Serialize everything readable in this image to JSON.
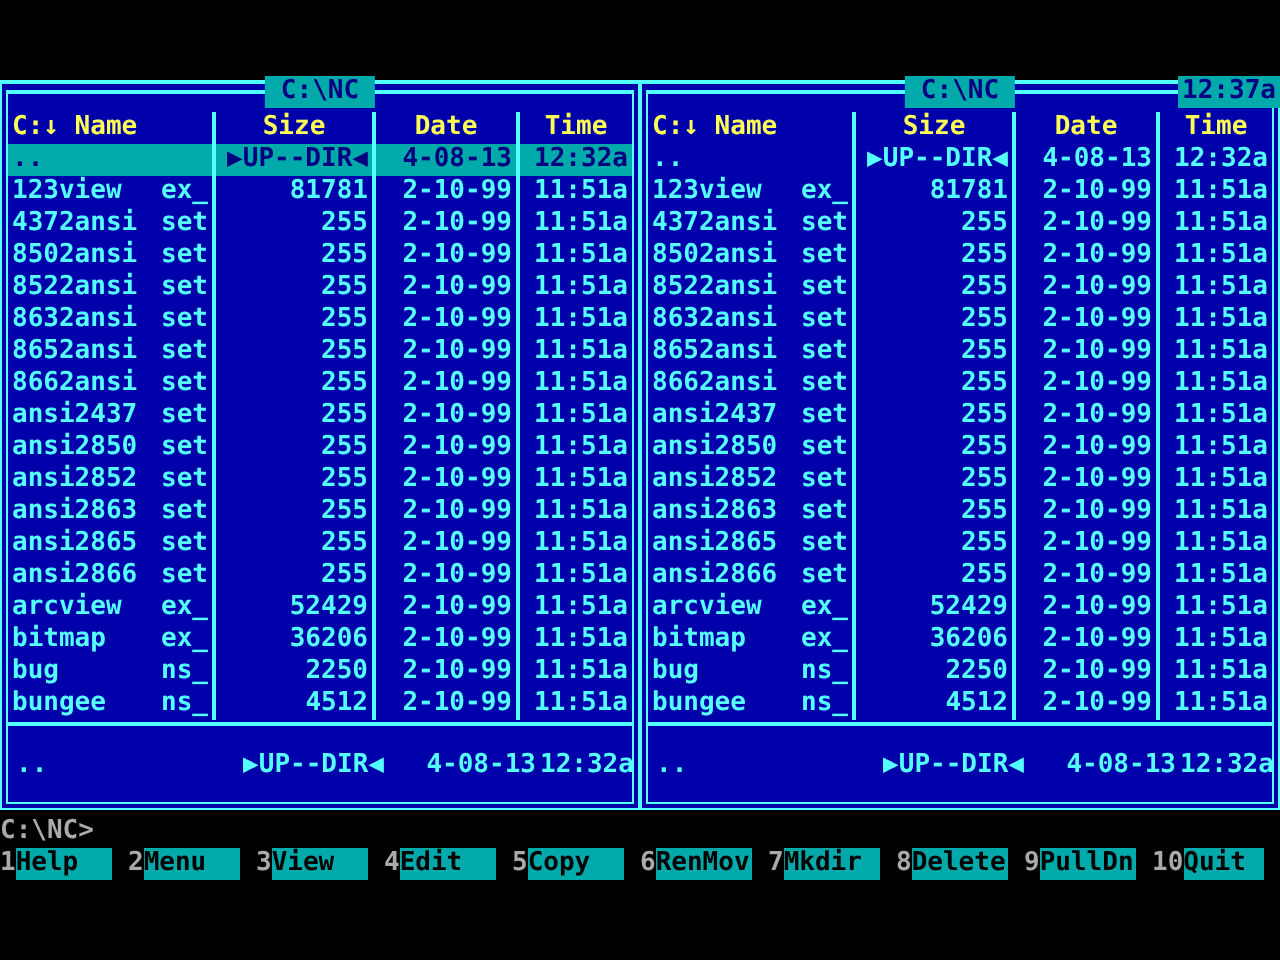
{
  "panels": [
    {
      "path": "C:\\NC",
      "columns": [
        "C:↓ Name",
        "Size",
        "Date",
        "Time"
      ],
      "files": [
        {
          "name": "..",
          "size": "▶UP--DIR◀",
          "date": "4-08-13",
          "time": "12:32a",
          "selected": true
        },
        {
          "name": "123view",
          "ext": "ex_",
          "size": "81781",
          "date": "2-10-99",
          "time": "11:51a",
          "selected": false
        },
        {
          "name": "4372ansi",
          "ext": "set",
          "size": "255",
          "date": "2-10-99",
          "time": "11:51a",
          "selected": false
        },
        {
          "name": "8502ansi",
          "ext": "set",
          "size": "255",
          "date": "2-10-99",
          "time": "11:51a",
          "selected": false
        },
        {
          "name": "8522ansi",
          "ext": "set",
          "size": "255",
          "date": "2-10-99",
          "time": "11:51a",
          "selected": false
        },
        {
          "name": "8632ansi",
          "ext": "set",
          "size": "255",
          "date": "2-10-99",
          "time": "11:51a",
          "selected": false
        },
        {
          "name": "8652ansi",
          "ext": "set",
          "size": "255",
          "date": "2-10-99",
          "time": "11:51a",
          "selected": false
        },
        {
          "name": "8662ansi",
          "ext": "set",
          "size": "255",
          "date": "2-10-99",
          "time": "11:51a",
          "selected": false
        },
        {
          "name": "ansi2437",
          "ext": "set",
          "size": "255",
          "date": "2-10-99",
          "time": "11:51a",
          "selected": false
        },
        {
          "name": "ansi2850",
          "ext": "set",
          "size": "255",
          "date": "2-10-99",
          "time": "11:51a",
          "selected": false
        },
        {
          "name": "ansi2852",
          "ext": "set",
          "size": "255",
          "date": "2-10-99",
          "time": "11:51a",
          "selected": false
        },
        {
          "name": "ansi2863",
          "ext": "set",
          "size": "255",
          "date": "2-10-99",
          "time": "11:51a",
          "selected": false
        },
        {
          "name": "ansi2865",
          "ext": "set",
          "size": "255",
          "date": "2-10-99",
          "time": "11:51a",
          "selected": false
        },
        {
          "name": "ansi2866",
          "ext": "set",
          "size": "255",
          "date": "2-10-99",
          "time": "11:51a",
          "selected": false
        },
        {
          "name": "arcview",
          "ext": "ex_",
          "size": "52429",
          "date": "2-10-99",
          "time": "11:51a",
          "selected": false
        },
        {
          "name": "bitmap",
          "ext": "ex_",
          "size": "36206",
          "date": "2-10-99",
          "time": "11:51a",
          "selected": false
        },
        {
          "name": "bug",
          "ext": "ns_",
          "size": "2250",
          "date": "2-10-99",
          "time": "11:51a",
          "selected": false
        },
        {
          "name": "bungee",
          "ext": "ns_",
          "size": "4512",
          "date": "2-10-99",
          "time": "11:51a",
          "selected": false
        }
      ],
      "status": {
        "name": "..",
        "size": "▶UP--DIR◀",
        "date": "4-08-13",
        "time": "12:32a"
      }
    },
    {
      "path": "C:\\NC",
      "clock": "12:37a",
      "columns": [
        "C:↓ Name",
        "Size",
        "Date",
        "Time"
      ],
      "files": [
        {
          "name": "..",
          "size": "▶UP--DIR◀",
          "date": "4-08-13",
          "time": "12:32a",
          "selected": false
        },
        {
          "name": "123view",
          "ext": "ex_",
          "size": "81781",
          "date": "2-10-99",
          "time": "11:51a",
          "selected": false
        },
        {
          "name": "4372ansi",
          "ext": "set",
          "size": "255",
          "date": "2-10-99",
          "time": "11:51a",
          "selected": false
        },
        {
          "name": "8502ansi",
          "ext": "set",
          "size": "255",
          "date": "2-10-99",
          "time": "11:51a",
          "selected": false
        },
        {
          "name": "8522ansi",
          "ext": "set",
          "size": "255",
          "date": "2-10-99",
          "time": "11:51a",
          "selected": false
        },
        {
          "name": "8632ansi",
          "ext": "set",
          "size": "255",
          "date": "2-10-99",
          "time": "11:51a",
          "selected": false
        },
        {
          "name": "8652ansi",
          "ext": "set",
          "size": "255",
          "date": "2-10-99",
          "time": "11:51a",
          "selected": false
        },
        {
          "name": "8662ansi",
          "ext": "set",
          "size": "255",
          "date": "2-10-99",
          "time": "11:51a",
          "selected": false
        },
        {
          "name": "ansi2437",
          "ext": "set",
          "size": "255",
          "date": "2-10-99",
          "time": "11:51a",
          "selected": false
        },
        {
          "name": "ansi2850",
          "ext": "set",
          "size": "255",
          "date": "2-10-99",
          "time": "11:51a",
          "selected": false
        },
        {
          "name": "ansi2852",
          "ext": "set",
          "size": "255",
          "date": "2-10-99",
          "time": "11:51a",
          "selected": false
        },
        {
          "name": "ansi2863",
          "ext": "set",
          "size": "255",
          "date": "2-10-99",
          "time": "11:51a",
          "selected": false
        },
        {
          "name": "ansi2865",
          "ext": "set",
          "size": "255",
          "date": "2-10-99",
          "time": "11:51a",
          "selected": false
        },
        {
          "name": "ansi2866",
          "ext": "set",
          "size": "255",
          "date": "2-10-99",
          "time": "11:51a",
          "selected": false
        },
        {
          "name": "arcview",
          "ext": "ex_",
          "size": "52429",
          "date": "2-10-99",
          "time": "11:51a",
          "selected": false
        },
        {
          "name": "bitmap",
          "ext": "ex_",
          "size": "36206",
          "date": "2-10-99",
          "time": "11:51a",
          "selected": false
        },
        {
          "name": "bug",
          "ext": "ns_",
          "size": "2250",
          "date": "2-10-99",
          "time": "11:51a",
          "selected": false
        },
        {
          "name": "bungee",
          "ext": "ns_",
          "size": "4512",
          "date": "2-10-99",
          "time": "11:51a",
          "selected": false
        }
      ],
      "status": {
        "name": "..",
        "size": "▶UP--DIR◀",
        "date": "4-08-13",
        "time": "12:32a"
      }
    }
  ],
  "command_line": {
    "prompt": "C:\\NC>"
  },
  "keybar": [
    {
      "number": "1",
      "label": "Help"
    },
    {
      "number": "2",
      "label": "Menu"
    },
    {
      "number": "3",
      "label": "View"
    },
    {
      "number": "4",
      "label": "Edit"
    },
    {
      "number": "5",
      "label": "Copy"
    },
    {
      "number": "6",
      "label": "RenMov"
    },
    {
      "number": "7",
      "label": "Mkdir"
    },
    {
      "number": "8",
      "label": "Delete"
    },
    {
      "number": "9",
      "label": "PullDn"
    },
    {
      "number": "10",
      "label": "Quit"
    }
  ]
}
